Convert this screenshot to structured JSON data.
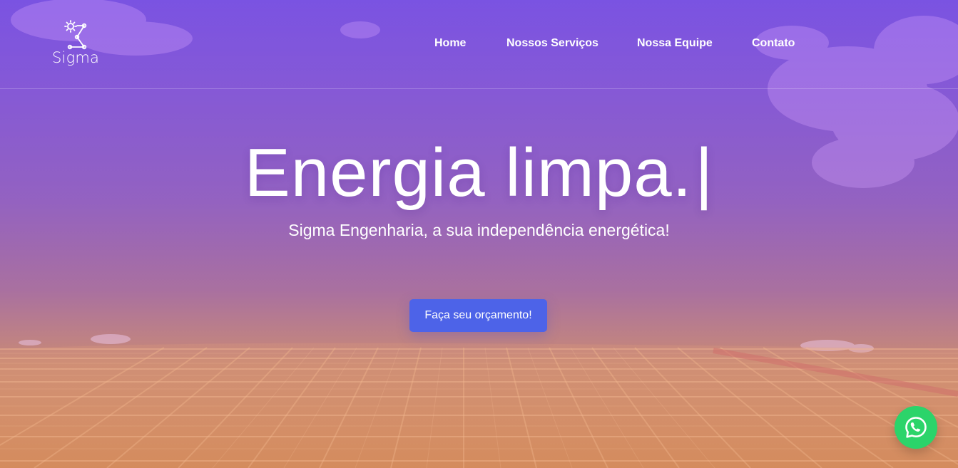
{
  "brand": {
    "logo_text": "Sigma",
    "logo_icon": "sun-network-sigma-icon"
  },
  "nav": {
    "items": [
      {
        "label": "Home"
      },
      {
        "label": "Nossos Serviços"
      },
      {
        "label": "Nossa Equipe"
      },
      {
        "label": "Contato"
      }
    ]
  },
  "hero": {
    "headline": "Energia limpa.",
    "caret": "|",
    "subtitle": "Sigma Engenharia, a sua independência energética!",
    "cta_label": "Faça seu orçamento!"
  },
  "floating_action": {
    "icon": "whatsapp-icon"
  },
  "colors": {
    "cta_blue": "#4d63e8",
    "whatsapp_green": "#2bd46a",
    "top_purple": "#6f44df",
    "bottom_orange": "#d79566"
  }
}
